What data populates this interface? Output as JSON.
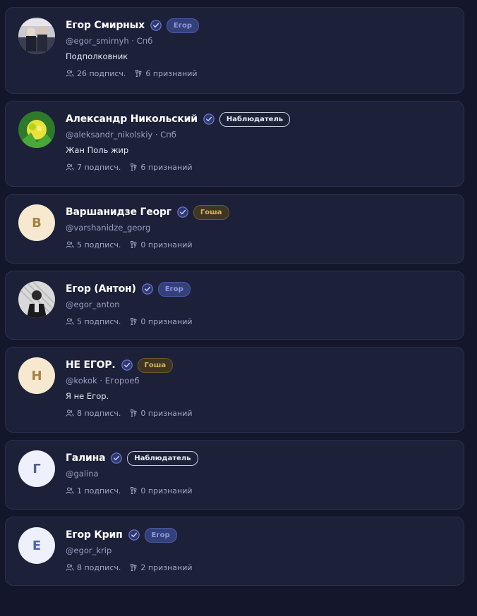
{
  "colors": {
    "background": "#14172b",
    "card": "#1c2038",
    "card_border": "#2b3050",
    "verified": "#6f7ad6",
    "badge_egor": "#8d9ae0",
    "badge_gosha": "#d6b25b"
  },
  "users": [
    {
      "name": "Егор Смирных",
      "verified_icon": "verified-check-icon",
      "badge": "Егор",
      "handle": "@egor_smirnyh · Спб",
      "bio": "Подполковник",
      "subscribers": "26 подписч.",
      "recognitions": "6 признаний",
      "avatar": "photo"
    },
    {
      "name": "Александр Никольский",
      "verified_icon": "verified-check-icon",
      "badge": "Наблюдатель",
      "handle": "@aleksandr_nikolskiy · Спб",
      "bio": "Жан Поль жир",
      "subscribers": "7 подписч.",
      "recognitions": "6 признаний",
      "avatar": "photo"
    },
    {
      "name": "Варшанидзе Георг",
      "verified_icon": "verified-check-icon",
      "badge": "Гоша",
      "handle": "@varshanidze_georg",
      "bio": "",
      "subscribers": "5 подписч.",
      "recognitions": "0 признаний",
      "avatar": "В"
    },
    {
      "name": "Егор (Антон)",
      "verified_icon": "verified-check-icon",
      "badge": "Егор",
      "handle": "@egor_anton",
      "bio": "",
      "subscribers": "5 подписч.",
      "recognitions": "0 признаний",
      "avatar": "photo"
    },
    {
      "name": "НЕ ЕГОР.",
      "verified_icon": "verified-check-icon",
      "badge": "Гоша",
      "handle": "@kokok · Егороеб",
      "bio": "Я не Егор.",
      "subscribers": "8 подписч.",
      "recognitions": "0 признаний",
      "avatar": "Н"
    },
    {
      "name": "Галина",
      "verified_icon": "verified-check-icon",
      "badge": "Наблюдатель",
      "handle": "@galina",
      "bio": "",
      "subscribers": "1 подписч.",
      "recognitions": "0 признаний",
      "avatar": "Г"
    },
    {
      "name": "Егор Крип",
      "verified_icon": "verified-check-icon",
      "badge": "Егор",
      "handle": "@egor_krip",
      "bio": "",
      "subscribers": "8 подписч.",
      "recognitions": "2 признаний",
      "avatar": "Е"
    }
  ]
}
